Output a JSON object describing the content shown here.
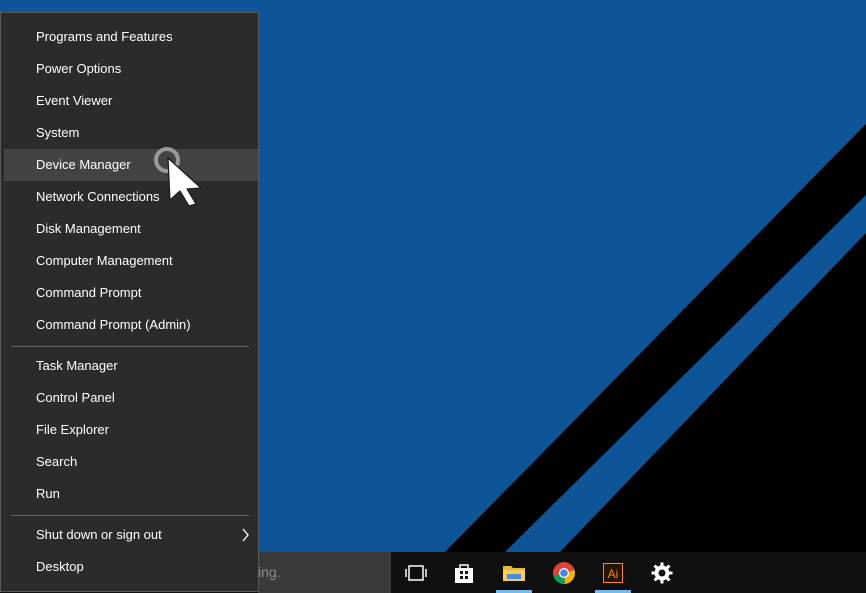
{
  "desktop": {
    "background_color": "#0e5597",
    "shape_color": "#000000"
  },
  "menu": {
    "group1": [
      {
        "id": "programs",
        "label": "Programs and Features"
      },
      {
        "id": "power",
        "label": "Power Options"
      },
      {
        "id": "event-viewer",
        "label": "Event Viewer"
      },
      {
        "id": "system",
        "label": "System"
      },
      {
        "id": "device-manager",
        "label": "Device Manager",
        "hovered": true
      },
      {
        "id": "network",
        "label": "Network Connections"
      },
      {
        "id": "disk",
        "label": "Disk Management"
      },
      {
        "id": "computer-mgmt",
        "label": "Computer Management"
      },
      {
        "id": "cmd",
        "label": "Command Prompt"
      },
      {
        "id": "cmd-admin",
        "label": "Command Prompt (Admin)"
      }
    ],
    "group2": [
      {
        "id": "task-manager",
        "label": "Task Manager"
      },
      {
        "id": "control-panel",
        "label": "Control Panel"
      },
      {
        "id": "file-explorer",
        "label": "File Explorer"
      },
      {
        "id": "search",
        "label": "Search"
      },
      {
        "id": "run",
        "label": "Run"
      }
    ],
    "group3": [
      {
        "id": "shutdown",
        "label": "Shut down or sign out",
        "submenu": true
      },
      {
        "id": "desktop",
        "label": "Desktop"
      }
    ]
  },
  "taskbar": {
    "search_fragment": "ing.",
    "icons": [
      {
        "name": "task-view-icon"
      },
      {
        "name": "store-icon"
      },
      {
        "name": "file-explorer-icon",
        "active": true
      },
      {
        "name": "chrome-icon"
      },
      {
        "name": "illustrator-icon",
        "label": "Ai",
        "active": true
      },
      {
        "name": "settings-icon"
      }
    ]
  }
}
